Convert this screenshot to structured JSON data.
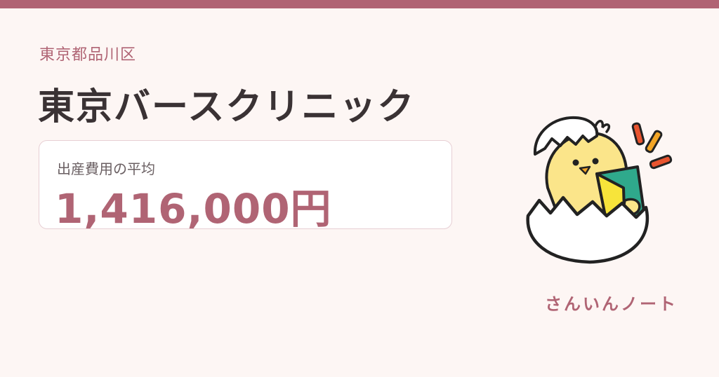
{
  "header": {
    "region": "東京都品川区",
    "clinic_name": "東京バースクリニック"
  },
  "cost_card": {
    "label": "出産費用の平均",
    "value": "1,416,000円"
  },
  "brand": {
    "name": "さんいんノート"
  },
  "colors": {
    "accent": "#b06474",
    "background": "#fdf6f4",
    "title_text": "#3a3234",
    "card_border": "#e7cfd4"
  },
  "mascot": {
    "icon": "chick-in-eggshell-reading-icon"
  }
}
